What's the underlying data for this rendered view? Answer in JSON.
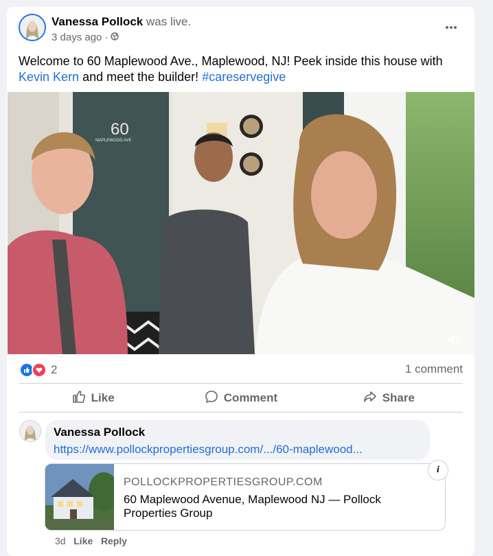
{
  "post": {
    "author": "Vanessa Pollock",
    "status": "was live.",
    "time": "3 days ago",
    "privacy_icon": "globe-icon",
    "more_icon": "more-horizontal-icon",
    "text_part1": "Welcome to 60 Maplewood Ave., Maplewood, NJ! Peek inside this house with ",
    "mention": "Kevin Kern",
    "text_part2": " and meet the builder!  ",
    "hashtag": "#careservegive",
    "video_sign": "60",
    "video_street": "MAPLEWOOD AVE"
  },
  "stats": {
    "reactions_count": "2",
    "comments_count": "1 comment"
  },
  "actions": {
    "like": "Like",
    "comment": "Comment",
    "share": "Share"
  },
  "comment": {
    "author": "Vanessa Pollock",
    "link": "https://www.pollockpropertiesgroup.com/.../60-maplewood...",
    "preview_domain": "POLLOCKPROPERTIESGROUP.COM",
    "preview_title": "60 Maplewood Avenue, Maplewood NJ — Pollock Properties Group",
    "time": "3d",
    "like": "Like",
    "reply": "Reply"
  },
  "colors": {
    "accent": "#1b74e4",
    "link": "#216fdb",
    "love": "#f33e58"
  }
}
